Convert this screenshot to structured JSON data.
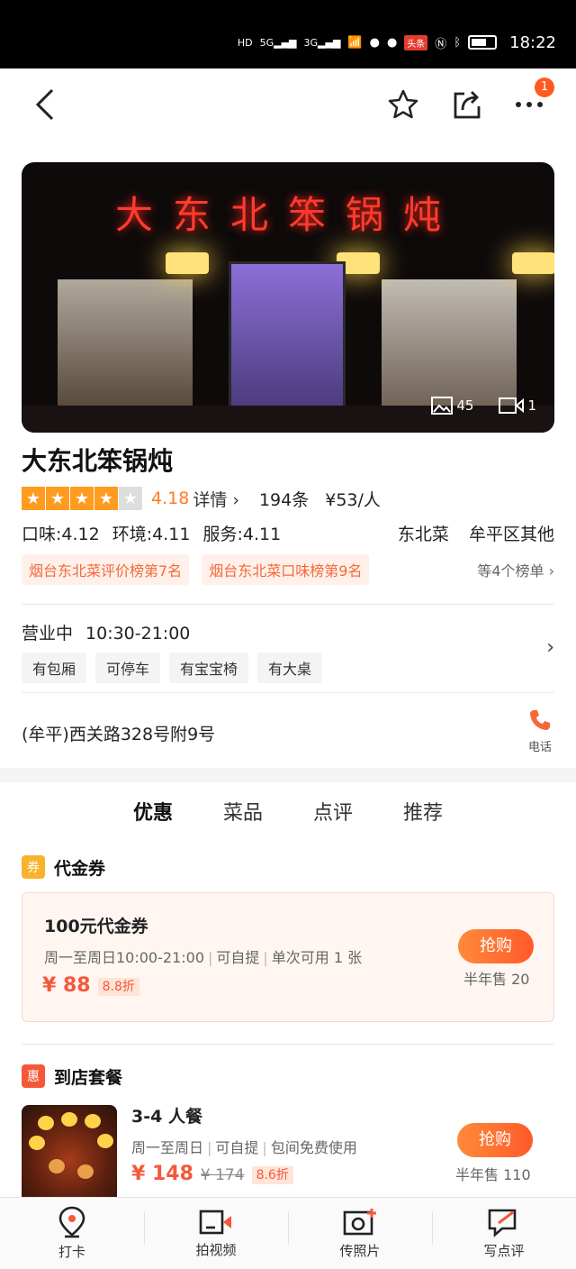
{
  "status_bar": {
    "time": "18:22",
    "hd": "HD",
    "sig1": "5G",
    "sig2": "3G",
    "toutiao": "头条"
  },
  "nav": {
    "notification_count": "1"
  },
  "hero": {
    "sign_text": "大东北笨锅炖",
    "photo_count": "45",
    "video_count": "1"
  },
  "shop": {
    "name": "大东北笨锅炖",
    "stars": 4,
    "score": "4.18",
    "detail_label": "详情",
    "reviews": "194条",
    "price_per_person": "¥53/人",
    "taste": "口味:4.12",
    "environment": "环境:4.11",
    "service": "服务:4.11",
    "cuisine": "东北菜",
    "area": "牟平区其他",
    "rankings": [
      "烟台东北菜评价榜第7名",
      "烟台东北菜口味榜第9名"
    ],
    "rankings_more": "等4个榜单",
    "status": "营业中",
    "hours": "10:30-21:00",
    "facilities": [
      "有包厢",
      "可停车",
      "有宝宝椅",
      "有大桌"
    ],
    "address": "(牟平)西关路328号附9号",
    "phone_label": "电话"
  },
  "tabs": [
    {
      "label": "优惠",
      "active": true
    },
    {
      "label": "菜品",
      "active": false
    },
    {
      "label": "点评",
      "active": false
    },
    {
      "label": "推荐",
      "active": false
    }
  ],
  "voucher_section": {
    "badge": "券",
    "badge_color": "#f7b32b",
    "title": "代金券",
    "item": {
      "title": "100元代金券",
      "rules": [
        "周一至周日10:00-21:00",
        "可自提",
        "单次可用 1 张"
      ],
      "price": "¥ 88",
      "discount": "8.8折",
      "buy_label": "抢购",
      "sold": "半年售 20"
    }
  },
  "combo_section": {
    "badge": "惠",
    "badge_color": "#f4583a",
    "title": "到店套餐",
    "item": {
      "title": "3-4 人餐",
      "rules": [
        "周一至周日",
        "可自提",
        "包间免费使用"
      ],
      "price": "¥ 148",
      "original_price": "¥ 174",
      "discount": "8.6折",
      "buy_label": "抢购",
      "sold": "半年售 110"
    }
  },
  "bottom_bar": [
    {
      "label": "打卡",
      "icon": "location-pin-icon"
    },
    {
      "label": "拍视频",
      "icon": "video-camera-icon"
    },
    {
      "label": "传照片",
      "icon": "add-photo-icon"
    },
    {
      "label": "写点评",
      "icon": "write-review-icon"
    }
  ],
  "colors": {
    "accent": "#ff7a1f",
    "price": "#f4583a",
    "star": "#ff9b1f"
  }
}
